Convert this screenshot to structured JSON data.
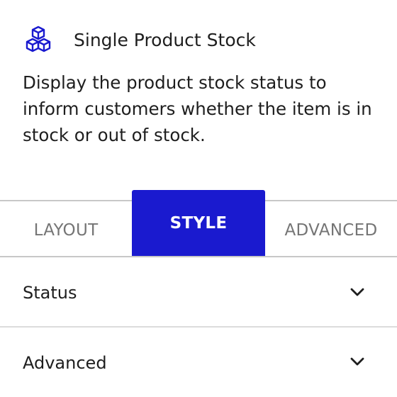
{
  "block": {
    "icon": "blocks-cubes-icon",
    "title": "Single Product Stock",
    "description": "Display the product stock status to inform customers whether the item is in stock or out of stock."
  },
  "tabs": [
    {
      "label": "LAYOUT",
      "active": false
    },
    {
      "label": "STYLE",
      "active": true
    },
    {
      "label": "ADVANCED",
      "active": false
    }
  ],
  "sections": [
    {
      "label": "Status",
      "icon": "chevron-down-icon"
    },
    {
      "label": "Advanced",
      "icon": "chevron-down-icon"
    }
  ],
  "colors": {
    "accent": "#1a1acf",
    "text": "#1e1e1e",
    "muted": "#757575",
    "divider": "#c8c8c8"
  }
}
